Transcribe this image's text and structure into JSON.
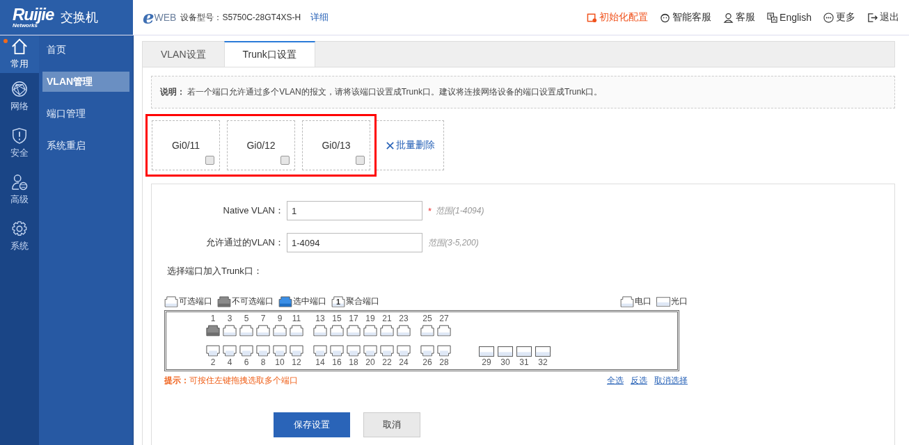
{
  "header": {
    "brand": "Ruijie",
    "brand_tagline": "Networks",
    "product": "交换机",
    "eweb_mark": "e",
    "eweb_text": "WEB",
    "model_label": "设备型号：",
    "model": "S5750C-28GT4XS-H",
    "details_link": "详细",
    "actions": [
      {
        "kind": "init",
        "label": "初始化配置"
      },
      {
        "kind": "assistant",
        "label": "智能客服"
      },
      {
        "kind": "service",
        "label": "客服"
      },
      {
        "kind": "language",
        "label": "English"
      },
      {
        "kind": "more",
        "label": "更多"
      },
      {
        "kind": "logout",
        "label": "退出"
      }
    ]
  },
  "rail": [
    {
      "kind": "home",
      "label": "常用",
      "selected": true,
      "notification": true
    },
    {
      "kind": "network",
      "label": "网络",
      "selected": false,
      "notification": false
    },
    {
      "kind": "security",
      "label": "安全",
      "selected": false,
      "notification": false
    },
    {
      "kind": "advanced",
      "label": "高级",
      "selected": false,
      "notification": false
    },
    {
      "kind": "system",
      "label": "系统",
      "selected": false,
      "notification": false
    }
  ],
  "submenu": [
    {
      "label": "首页",
      "selected": false
    },
    {
      "label": "VLAN管理",
      "selected": true
    },
    {
      "label": "端口管理",
      "selected": false
    },
    {
      "label": "系统重启",
      "selected": false
    }
  ],
  "tabs": [
    {
      "label": "VLAN设置",
      "selected": false
    },
    {
      "label": "Trunk口设置",
      "selected": true
    }
  ],
  "notice": {
    "title": "说明：",
    "text": "若一个端口允许通过多个VLAN的报文，请将该端口设置成Trunk口。建议将连接网络设备的端口设置成Trunk口。"
  },
  "trunk_ports": [
    {
      "label": "Gi0/11",
      "checked": false
    },
    {
      "label": "Gi0/12",
      "checked": false
    },
    {
      "label": "Gi0/13",
      "checked": false
    }
  ],
  "batch_delete": "批量删除",
  "form": {
    "fields": [
      {
        "label": "Native VLAN：",
        "value": "1",
        "required_mark": "*",
        "hint": "范围(1-4094)"
      },
      {
        "label": "允许通过的VLAN：",
        "value": "1-4094",
        "hint": "范围(3-5,200)"
      }
    ],
    "port_select_label": "选择端口加入Trunk口："
  },
  "legend": [
    {
      "kind": "available",
      "label": "可选端口"
    },
    {
      "kind": "unavailable",
      "label": "不可选端口"
    },
    {
      "kind": "selected",
      "label": "选中端口"
    },
    {
      "kind": "aggregate",
      "label": "聚合端口",
      "number": "1"
    }
  ],
  "media_legend": [
    {
      "kind": "copper",
      "label": "电口"
    },
    {
      "kind": "fiber",
      "label": "光口"
    }
  ],
  "port_groups": [
    {
      "top": [
        {
          "label": "1",
          "kind": "copper",
          "disabled": true
        },
        {
          "label": "3",
          "kind": "copper",
          "disabled": false
        },
        {
          "label": "5",
          "kind": "copper",
          "disabled": false
        },
        {
          "label": "7",
          "kind": "copper",
          "disabled": false
        },
        {
          "label": "9",
          "kind": "copper",
          "disabled": false
        },
        {
          "label": "11",
          "kind": "copper",
          "disabled": false
        }
      ],
      "bottom": [
        {
          "label": "2",
          "kind": "copper",
          "disabled": false
        },
        {
          "label": "4",
          "kind": "copper",
          "disabled": false
        },
        {
          "label": "6",
          "kind": "copper",
          "disabled": false
        },
        {
          "label": "8",
          "kind": "copper",
          "disabled": false
        },
        {
          "label": "10",
          "kind": "copper",
          "disabled": false
        },
        {
          "label": "12",
          "kind": "copper",
          "disabled": false
        }
      ]
    },
    {
      "top": [
        {
          "label": "13",
          "kind": "copper",
          "disabled": false
        },
        {
          "label": "15",
          "kind": "copper",
          "disabled": false
        },
        {
          "label": "17",
          "kind": "copper",
          "disabled": false
        },
        {
          "label": "19",
          "kind": "copper",
          "disabled": false
        },
        {
          "label": "21",
          "kind": "copper",
          "disabled": false
        },
        {
          "label": "23",
          "kind": "copper",
          "disabled": false
        }
      ],
      "bottom": [
        {
          "label": "14",
          "kind": "copper",
          "disabled": false
        },
        {
          "label": "16",
          "kind": "copper",
          "disabled": false
        },
        {
          "label": "18",
          "kind": "copper",
          "disabled": false
        },
        {
          "label": "20",
          "kind": "copper",
          "disabled": false
        },
        {
          "label": "22",
          "kind": "copper",
          "disabled": false
        },
        {
          "label": "24",
          "kind": "copper",
          "disabled": false
        }
      ]
    },
    {
      "top": [
        {
          "label": "25",
          "kind": "copper",
          "disabled": false
        },
        {
          "label": "27",
          "kind": "copper",
          "disabled": false
        }
      ],
      "bottom": [
        {
          "label": "26",
          "kind": "copper",
          "disabled": false
        },
        {
          "label": "28",
          "kind": "copper",
          "disabled": false
        }
      ]
    },
    {
      "bottom": [
        {
          "label": "29",
          "kind": "fiber",
          "disabled": false
        },
        {
          "label": "30",
          "kind": "fiber",
          "disabled": false
        },
        {
          "label": "31",
          "kind": "fiber",
          "disabled": false
        },
        {
          "label": "32",
          "kind": "fiber",
          "disabled": false
        }
      ]
    }
  ],
  "tip": {
    "title": "提示：",
    "text": "可按住左键拖拽选取多个端口"
  },
  "selection_links": [
    "全选",
    "反选",
    "取消选择"
  ],
  "buttons": [
    {
      "kind": "primary",
      "label": "保存设置"
    },
    {
      "kind": "secondary",
      "label": "取消"
    }
  ]
}
